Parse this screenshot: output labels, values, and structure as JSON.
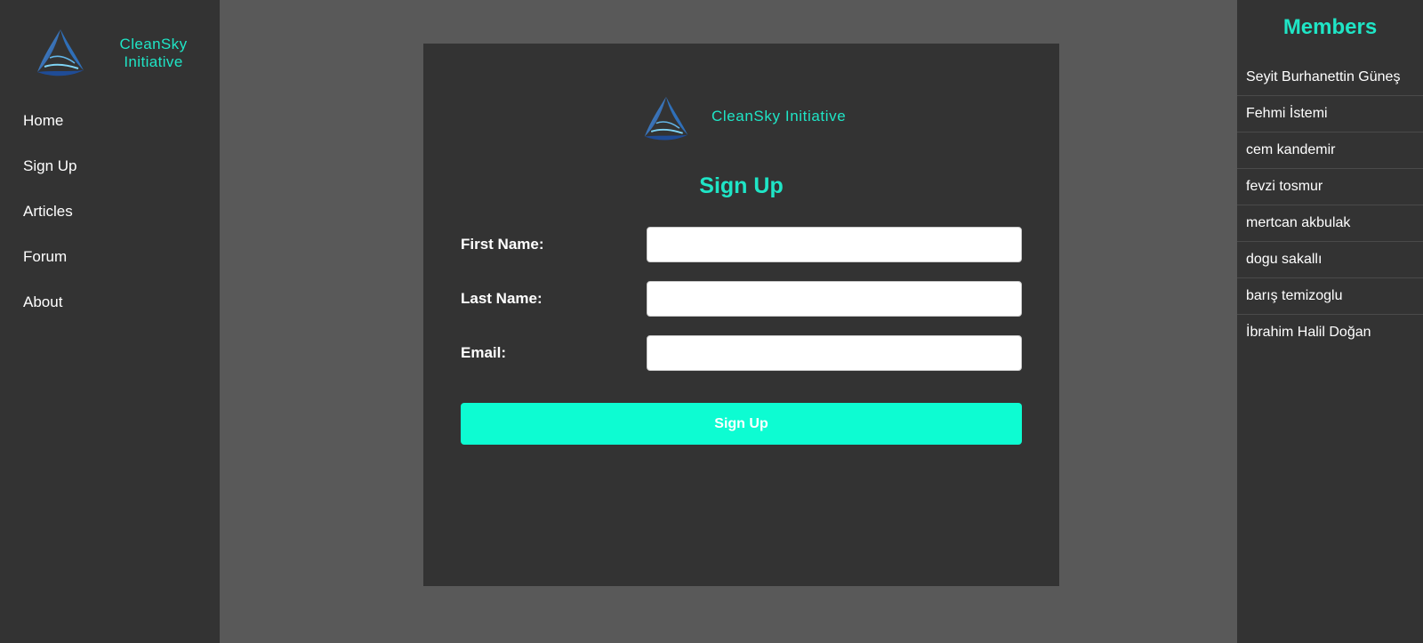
{
  "sidebar": {
    "brand_line1": "CleanSky",
    "brand_line2": "Initiative",
    "logo_icon": "triangle-swirl-logo-icon",
    "nav": [
      {
        "label": "Home"
      },
      {
        "label": "Sign Up"
      },
      {
        "label": "Articles"
      },
      {
        "label": "Forum"
      },
      {
        "label": "About"
      }
    ]
  },
  "card": {
    "brand_text": "CleanSky Initiative",
    "title": "Sign Up",
    "fields": {
      "first_name": {
        "label": "First Name:",
        "value": ""
      },
      "last_name": {
        "label": "Last Name:",
        "value": ""
      },
      "email": {
        "label": "Email:",
        "value": ""
      }
    },
    "submit_label": "Sign Up"
  },
  "members": {
    "title": "Members",
    "items": [
      "Seyit Burhanettin Güneş",
      "Fehmi İstemi",
      "cem kandemir",
      "fevzi tosmur",
      "mertcan akbulak",
      "dogu sakallı",
      "barış temizoglu",
      "İbrahim Halil Doğan"
    ]
  },
  "colors": {
    "accent": "#1fe5c6",
    "button": "#0dfcd2",
    "panel": "#333333",
    "background": "#595959"
  }
}
